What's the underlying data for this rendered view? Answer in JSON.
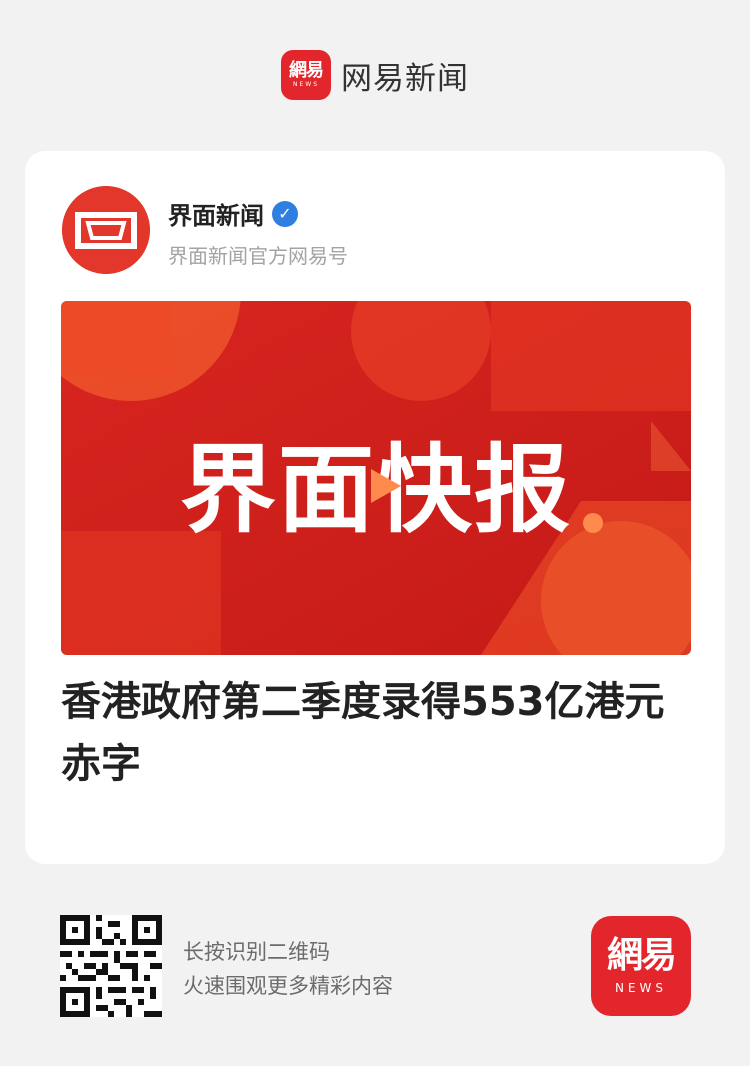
{
  "header": {
    "logo_text": "網易",
    "logo_sub": "NEWS",
    "app_name": "网易新闻"
  },
  "article": {
    "author_name": "界面新闻",
    "verified_mark": "✓",
    "author_subtitle": "界面新闻官方网易号",
    "banner_text": "界面快报",
    "headline": "香港政府第二季度录得553亿港元赤字"
  },
  "footer": {
    "line1": "长按识别二维码",
    "line2": "火速围观更多精彩内容",
    "logo_text": "網易",
    "logo_sub": "NEWS"
  },
  "colors": {
    "brand_red": "#e3262b",
    "verified_blue": "#2f7fe0"
  }
}
